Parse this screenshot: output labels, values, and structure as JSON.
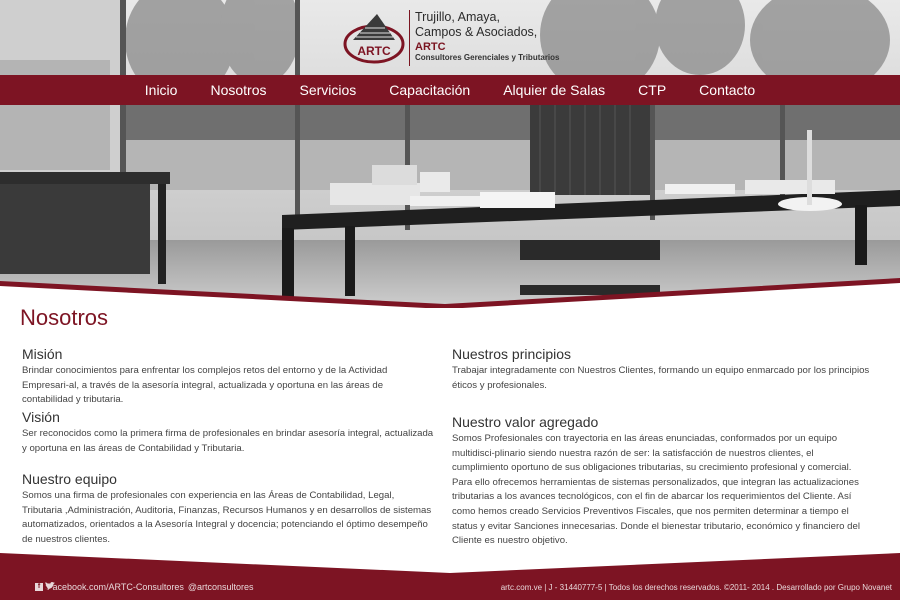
{
  "brand": {
    "logo_mark_text": "ARTC",
    "name_line1": "Trujillo, Amaya,",
    "name_line2": "Campos & Asociados,",
    "abbr": "ARTC",
    "tagline": "Consultores Gerenciales y Tributarios",
    "accent_color": "#7d1423"
  },
  "nav": {
    "items": [
      "Inicio",
      "Nosotros",
      "Servicios",
      "Capacitación",
      "Alquier de Salas",
      "CTP",
      "Contacto"
    ]
  },
  "page": {
    "title": "Nosotros"
  },
  "sections": {
    "mision": {
      "heading": "Misión",
      "body": "Brindar conocimientos para enfrentar los complejos retos del entorno y de la Actividad Empresari-al, a través de la asesoría integral, actualizada y oportuna en las áreas de contabilidad y tributaria."
    },
    "vision": {
      "heading": "Visión",
      "body": "Ser reconocidos como la primera firma de profesionales en brindar asesoría integral, actualizada y oportuna en las áreas de Contabilidad y Tributaria."
    },
    "equipo": {
      "heading": "Nuestro equipo",
      "body": "Somos una firma de profesionales con experiencia en las Áreas de Contabilidad, Legal, Tributaria ,Administración, Auditoria, Finanzas, Recursos Humanos y en desarrollos de sistemas automatizados, orientados a la Asesoría Integral y docencia; potenciando el óptimo desempeño de nuestros clientes."
    },
    "principios": {
      "heading": "Nuestros principios",
      "body": "Trabajar integradamente con Nuestros Clientes, formando un equipo enmarcado por los principios éticos y profesionales."
    },
    "valor": {
      "heading": "Nuestro valor agregado",
      "body": "Somos Profesionales con trayectoria en las áreas enunciadas, conformados por un equipo multidisci-plinario siendo nuestra razón de ser: la satisfacción de nuestros clientes, el cumplimiento oportuno de sus obligaciones tributarias, su crecimiento profesional y comercial. Para ello ofrecemos herramientas de sistemas personalizados, que integran las actualizaciones tributarias a los avances tecnológicos, con el fin de abarcar los requerimientos del Cliente. Así como hemos creado Servicios Preventivos Fiscales, que nos permiten determinar a tiempo el status y evitar Sanciones innecesarias. Donde el bienestar tributario, económico y financiero del Cliente es nuestro objetivo."
    }
  },
  "footer": {
    "facebook_icon": "facebook-icon",
    "facebook_text": "Facebook.com/ARTC-Consultores",
    "twitter_icon": "twitter-icon",
    "twitter_text": "@artconsultores",
    "right_text": "artc.com.ve | J - 31440777-5 | Todos los derechos reservados. ©2011- 2014 . Desarrollado por  Grupo Novanet"
  }
}
